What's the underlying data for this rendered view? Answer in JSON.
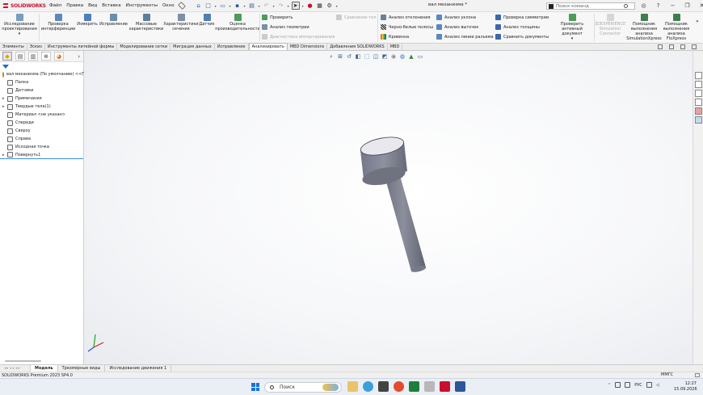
{
  "app": {
    "brand": "SOLIDWORKS",
    "document_title": "вал механизма *"
  },
  "menu": [
    "Файл",
    "Правка",
    "Вид",
    "Вставка",
    "Инструменты",
    "Окно"
  ],
  "search": {
    "placeholder": "Поиск команд"
  },
  "ribbon": {
    "large": [
      {
        "label": "Исследование проектирования",
        "icon": "design-study-icon"
      },
      {
        "label": "Проверка интерференции",
        "icon": "interference-icon"
      },
      {
        "label": "Измерить",
        "icon": "measure-icon"
      },
      {
        "label": "Исправление",
        "icon": "repair-icon"
      },
      {
        "label": "Массовые характеристики",
        "icon": "mass-properties-icon"
      },
      {
        "label": "Характеристики сечения",
        "icon": "section-properties-icon"
      },
      {
        "label": "Датчик",
        "icon": "sensor-icon"
      },
      {
        "label": "Оценка производительности",
        "icon": "performance-icon"
      }
    ],
    "check": "Проверить",
    "geometry_analysis": "Анализ геометрии",
    "import_diagnostics": "Диагностика импортирования",
    "compare_docs_disabled": "Сравнение тел",
    "deviation": "Анализ отклонения",
    "zebra": "Черно-белые полосы",
    "curvature": "Кривизна",
    "draft": "Анализ уклона",
    "undercut": "Анализ выточек",
    "parting_line": "Анализ линии разъема",
    "symmetry": "Проверка симметрии",
    "thickness": "Анализ толщины",
    "compare": "Сравнить документы",
    "check_active": "Проверить активный документ",
    "connector": "3DEXPERIENCE Simulation Connector",
    "simxpress": "Помощник выполнения анализа SimulationXpress",
    "floxpress": "Помощник выполнения анализа FloXpress"
  },
  "tabs": [
    {
      "label": "Элементы",
      "active": false
    },
    {
      "label": "Эскиз",
      "active": false
    },
    {
      "label": "Инструменты литейной формы",
      "active": false
    },
    {
      "label": "Моделирование сетки",
      "active": false
    },
    {
      "label": "Миграция данных",
      "active": false
    },
    {
      "label": "Исправление",
      "active": false
    },
    {
      "label": "Анализировать",
      "active": true
    },
    {
      "label": "MBD Dimensions",
      "active": false
    },
    {
      "label": "Добавления SOLIDWORKS",
      "active": false
    },
    {
      "label": "MBD",
      "active": false
    }
  ],
  "tree": {
    "root": "вал механизма  (По умолчанию) <<По у",
    "items": [
      {
        "label": "Папка",
        "icon": "folder-icon",
        "expand": false
      },
      {
        "label": "Датчики",
        "icon": "sensor-icon",
        "expand": false
      },
      {
        "label": "Примечания",
        "icon": "annotations-icon",
        "expand": true
      },
      {
        "label": "Твердые тела(1)",
        "icon": "solid-bodies-icon",
        "expand": true
      },
      {
        "label": "Материал <не указан>",
        "icon": "material-icon",
        "expand": false
      },
      {
        "label": "Спереди",
        "icon": "plane-icon",
        "expand": false
      },
      {
        "label": "Сверху",
        "icon": "plane-icon",
        "expand": false
      },
      {
        "label": "Справа",
        "icon": "plane-icon",
        "expand": false
      },
      {
        "label": "Исходная точка",
        "icon": "origin-icon",
        "expand": false
      },
      {
        "label": "Повернуть1",
        "icon": "revolve-icon",
        "expand": true
      }
    ]
  },
  "bottom_tabs": [
    {
      "label": "Модель",
      "active": true
    },
    {
      "label": "Трехмерные виды",
      "active": false
    },
    {
      "label": "Исследование движения 1",
      "active": false
    }
  ],
  "status": {
    "version": "SOLIDWORKS Premium 2023 SP4.0",
    "units": "ММГС"
  },
  "taskbar": {
    "search": "Поиск",
    "lang": "РУС",
    "time": "12:27",
    "date": "15.09.2026"
  },
  "colors": {
    "brand": "#c8102e",
    "accent": "#1f6fb2",
    "part": "#8a8d99"
  }
}
